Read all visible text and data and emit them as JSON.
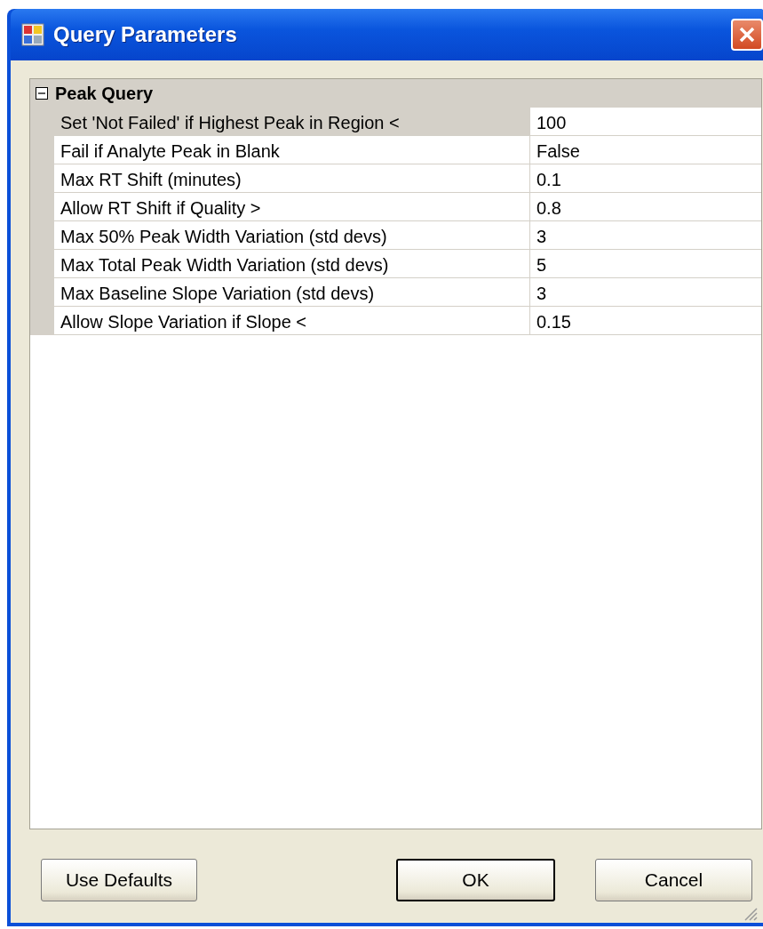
{
  "window": {
    "title": "Query Parameters"
  },
  "category": {
    "label": "Peak Query",
    "expanded": true
  },
  "properties": [
    {
      "label": "Set 'Not Failed' if Highest Peak in Region <",
      "value": "100",
      "selected": true
    },
    {
      "label": "Fail if Analyte Peak in Blank",
      "value": "False",
      "selected": false
    },
    {
      "label": "Max RT Shift (minutes)",
      "value": "0.1",
      "selected": false
    },
    {
      "label": "Allow RT Shift if Quality >",
      "value": "0.8",
      "selected": false
    },
    {
      "label": "Max 50% Peak Width Variation (std devs)",
      "value": "3",
      "selected": false
    },
    {
      "label": "Max Total Peak Width Variation (std devs)",
      "value": "5",
      "selected": false
    },
    {
      "label": "Max Baseline Slope Variation (std devs)",
      "value": "3",
      "selected": false
    },
    {
      "label": "Allow Slope Variation if Slope <",
      "value": "0.15",
      "selected": false
    }
  ],
  "buttons": [
    {
      "label": "Use Defaults",
      "default": false
    },
    {
      "label": "OK",
      "default": true
    },
    {
      "label": "Cancel",
      "default": false
    }
  ]
}
